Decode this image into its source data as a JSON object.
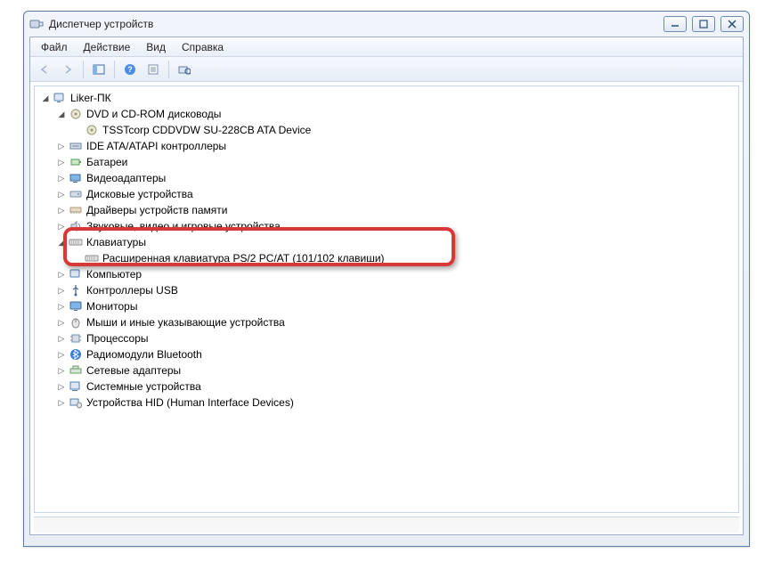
{
  "window": {
    "title": "Диспетчер устройств"
  },
  "menu": {
    "file": "Файл",
    "action": "Действие",
    "view": "Вид",
    "help": "Справка"
  },
  "tree": {
    "root": "Liker-ПК",
    "dvd": {
      "label": "DVD и CD-ROM дисководы",
      "child": "TSSTcorp CDDVDW SU-228CB ATA Device"
    },
    "ide": "IDE ATA/ATAPI контроллеры",
    "batteries": "Батареи",
    "video": "Видеоадаптеры",
    "disks": "Дисковые устройства",
    "memdrv": "Драйверы устройств памяти",
    "sound": "Звуковые, видео и игровые устройства",
    "keyboards": {
      "label": "Клавиатуры",
      "child": "Расширенная клавиатура PS/2 PC/AT (101/102 клавиши)"
    },
    "computer": "Компьютер",
    "usb": "Контроллеры USB",
    "monitors": "Мониторы",
    "mice": "Мыши и иные указывающие устройства",
    "cpu": "Процессоры",
    "bluetooth": "Радиомодули Bluetooth",
    "netadapters": "Сетевые адаптеры",
    "sysdev": "Системные устройства",
    "hid": "Устройства HID (Human Interface Devices)"
  }
}
